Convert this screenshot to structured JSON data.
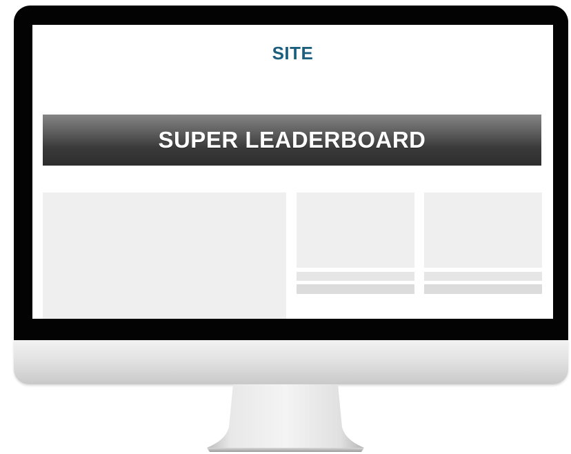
{
  "site": {
    "title": "SITE"
  },
  "ad": {
    "leaderboard_label": "SUPER LEADERBOARD"
  },
  "colors": {
    "title": "#1c5e7d",
    "bezel": "#030303",
    "placeholder": "#efefef",
    "placeholder_bar": "#dcdcdc"
  }
}
